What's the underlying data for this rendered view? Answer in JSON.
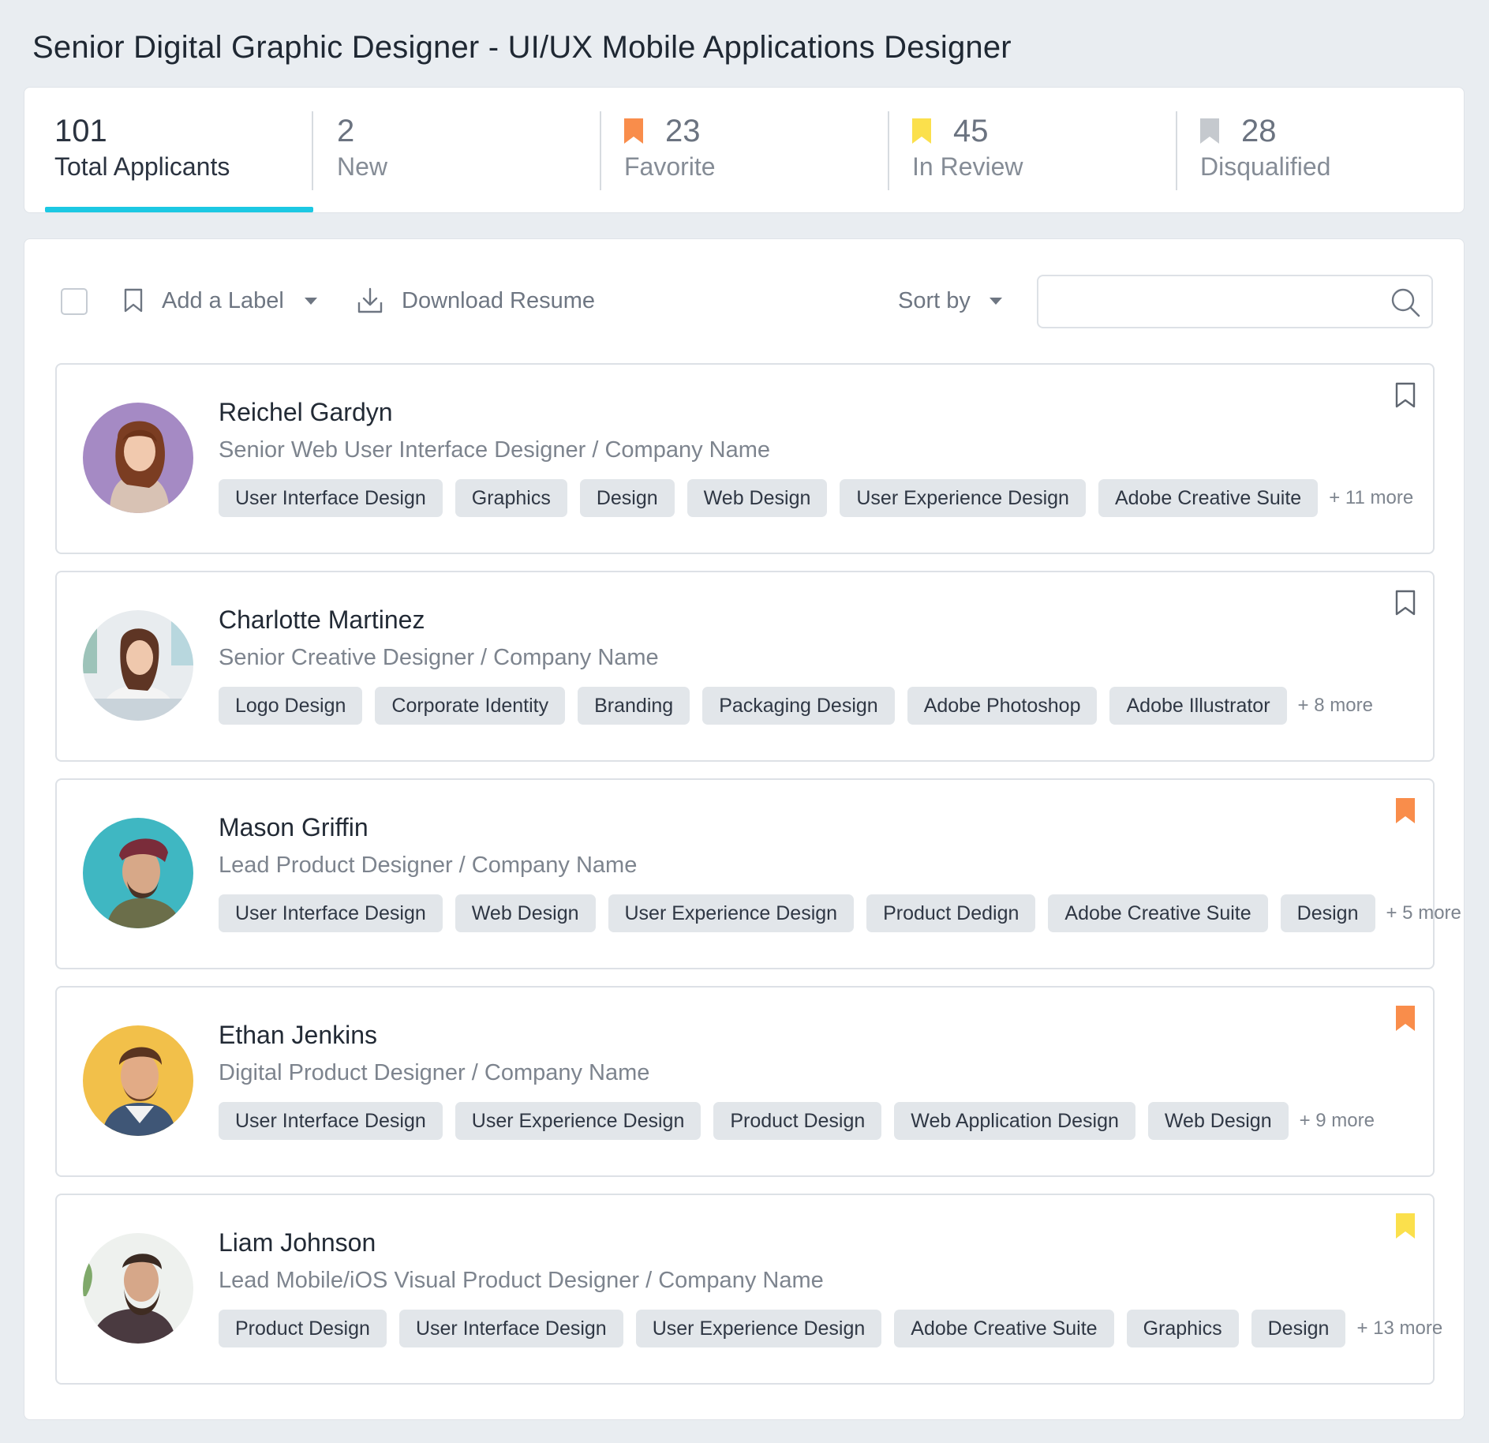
{
  "page_title": "Senior Digital Graphic Designer - UI/UX Mobile Applications Designer",
  "stats": [
    {
      "count": "101",
      "label": "Total Applicants",
      "flag": null
    },
    {
      "count": "2",
      "label": "New",
      "flag": null
    },
    {
      "count": "23",
      "label": "Favorite",
      "flag": "#f98d4b"
    },
    {
      "count": "45",
      "label": "In Review",
      "flag": "#fbe04c"
    },
    {
      "count": "28",
      "label": "Disqualified",
      "flag": "#c5c9ce"
    }
  ],
  "toolbar": {
    "add_label": "Add a Label",
    "download_resume": "Download Resume",
    "sort_by": "Sort by",
    "search_placeholder": ""
  },
  "colors": {
    "accent": "#1cc8e3",
    "favorite": "#f98d4b",
    "in_review": "#fbe04c",
    "disqualified": "#c5c9ce"
  },
  "applicants": [
    {
      "name": "Reichel Gardyn",
      "role": "Senior Web User Interface Designer / Company Name",
      "tags": [
        "User Interface Design",
        "Graphics",
        "Design",
        "Web Design",
        "User Experience Design",
        "Adobe Creative Suite"
      ],
      "more": "+ 11 more",
      "bookmark": "outline"
    },
    {
      "name": "Charlotte Martinez",
      "role": "Senior Creative Designer / Company Name",
      "tags": [
        "Logo Design",
        "Corporate Identity",
        "Branding",
        "Packaging Design",
        "Adobe Photoshop",
        "Adobe Illustrator"
      ],
      "more": "+ 8 more",
      "bookmark": "outline"
    },
    {
      "name": "Mason Griffin",
      "role": "Lead Product Designer / Company Name",
      "tags": [
        "User Interface Design",
        "Web Design",
        "User Experience Design",
        "Product Dedign",
        "Adobe Creative Suite",
        "Design"
      ],
      "more": "+ 5 more",
      "bookmark": "favorite"
    },
    {
      "name": "Ethan Jenkins",
      "role": "Digital Product Designer / Company Name",
      "tags": [
        "User Interface Design",
        "User Experience Design",
        "Product Design",
        "Web Application Design",
        "Web Design"
      ],
      "more": "+ 9 more",
      "bookmark": "favorite"
    },
    {
      "name": "Liam Johnson",
      "role": "Lead Mobile/iOS Visual Product Designer / Company Name",
      "tags": [
        "Product Design",
        "User Interface Design",
        "User Experience Design",
        "Adobe Creative Suite",
        "Graphics",
        "Design"
      ],
      "more": "+ 13 more",
      "bookmark": "in_review"
    }
  ]
}
